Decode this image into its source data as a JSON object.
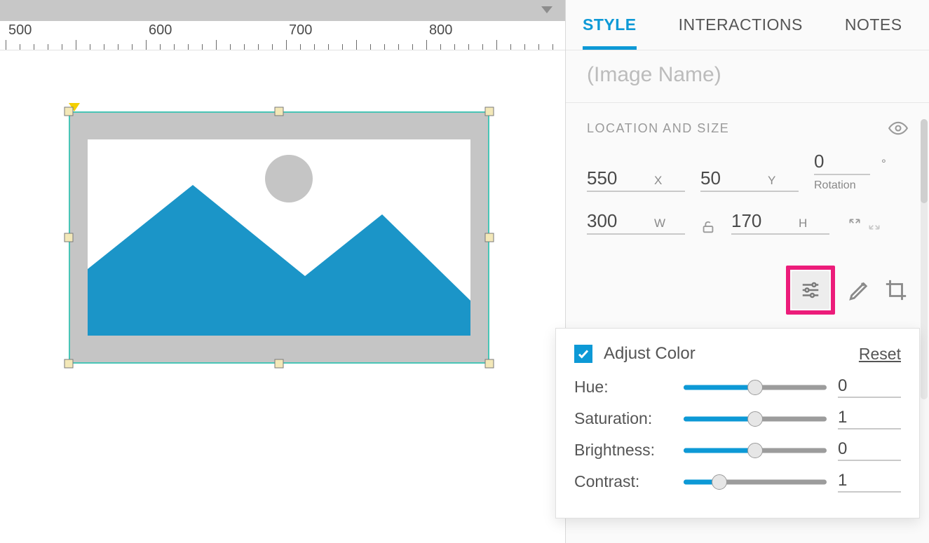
{
  "ruler": {
    "marks": [
      "500",
      "600",
      "700",
      "800"
    ]
  },
  "tabs": {
    "style": "STYLE",
    "interactions": "INTERACTIONS",
    "notes": "NOTES"
  },
  "nameField": {
    "placeholder": "(Image Name)",
    "value": ""
  },
  "section": {
    "title": "LOCATION AND SIZE"
  },
  "loc": {
    "x": "550",
    "y": "50",
    "rotation": "0",
    "rotationLabel": "Rotation",
    "w": "300",
    "h": "170"
  },
  "labels": {
    "x": "X",
    "y": "Y",
    "deg": "°",
    "w": "W",
    "h": "H"
  },
  "adjust": {
    "title": "Adjust Color",
    "reset": "Reset",
    "rows": {
      "hue": {
        "label": "Hue:",
        "value": "0",
        "pct": 50
      },
      "saturation": {
        "label": "Saturation:",
        "value": "1",
        "pct": 50
      },
      "brightness": {
        "label": "Brightness:",
        "value": "0",
        "pct": 50
      },
      "contrast": {
        "label": "Contrast:",
        "value": "1",
        "pct": 25
      }
    }
  },
  "colors": {
    "accent": "#0d99d6",
    "highlight": "#ec1c7a",
    "selection": "#49c5b6",
    "mountain": "#1b95c8"
  }
}
